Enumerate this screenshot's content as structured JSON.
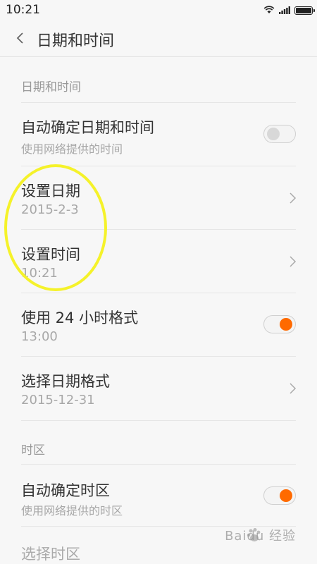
{
  "status_bar": {
    "time": "10:21"
  },
  "header": {
    "title": "日期和时间"
  },
  "sections": {
    "date_time": "日期和时间",
    "timezone": "时区"
  },
  "rows": {
    "auto_datetime": {
      "title": "自动确定日期和时间",
      "subtitle": "使用网络提供的时间",
      "toggle_on": false
    },
    "set_date": {
      "title": "设置日期",
      "subtitle": "2015-2-3"
    },
    "set_time": {
      "title": "设置时间",
      "subtitle": "10:21"
    },
    "use_24h": {
      "title": "使用 24 小时格式",
      "subtitle": "13:00",
      "toggle_on": true
    },
    "date_format": {
      "title": "选择日期格式",
      "subtitle": "2015-12-31"
    },
    "auto_timezone": {
      "title": "自动确定时区",
      "subtitle": "使用网络提供的时区",
      "toggle_on": true
    },
    "select_timezone": {
      "title": "选择时区"
    }
  },
  "watermark": {
    "text": "Baidu 经验"
  },
  "colors": {
    "accent": "#ff6a00",
    "highlight": "#f5f22a"
  }
}
